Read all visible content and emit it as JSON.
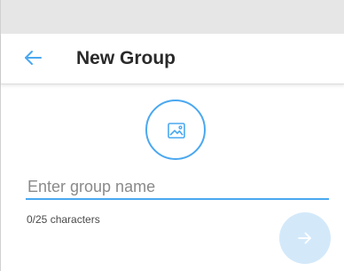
{
  "header": {
    "title": "New Group",
    "back_icon": "arrow-left-icon"
  },
  "group_photo": {
    "icon": "image-icon"
  },
  "group_name": {
    "value": "",
    "placeholder": "Enter group name"
  },
  "counter": {
    "text": "0/25 characters"
  },
  "next_button": {
    "icon": "arrow-right-icon"
  },
  "colors": {
    "accent": "#4aa8f0",
    "fab_disabled": "#d3e9fa",
    "status_bar": "#e6e6e6"
  }
}
